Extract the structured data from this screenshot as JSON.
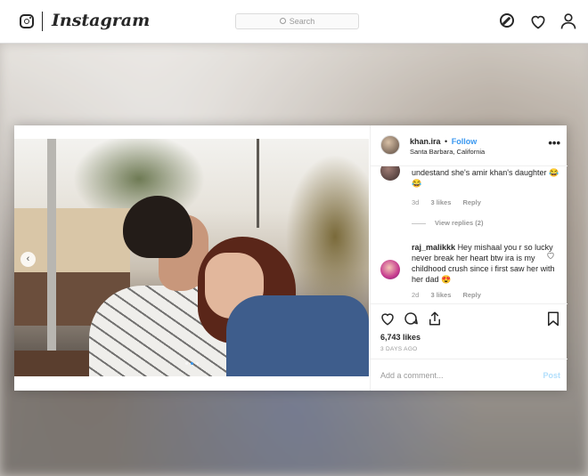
{
  "nav": {
    "logo": "Instagram",
    "search_placeholder": "Search"
  },
  "post": {
    "username": "khan.ira",
    "separator": "•",
    "follow_label": "Follow",
    "location": "Santa Barbara, California",
    "more_label": "•••",
    "carousel_prev": "‹",
    "carousel_dots": 3,
    "carousel_active": 1
  },
  "comments": [
    {
      "text": "undestand she's amir khan's daughter 😂😂",
      "age": "3d",
      "likes": "3 likes",
      "reply_label": "Reply",
      "view_replies": "View replies (2)"
    },
    {
      "user": "raj_malikkk",
      "text": "Hey mishaal you r so lucky never break her heart btw ira is my childhood crush since i first saw her with her dad 😍",
      "age": "2d",
      "likes": "3 likes",
      "reply_label": "Reply"
    }
  ],
  "footer": {
    "likes": "6,743 likes",
    "time": "3 DAYS AGO",
    "add_comment_placeholder": "Add a comment...",
    "post_label": "Post"
  },
  "colors": {
    "link_blue": "#3897f0",
    "post_disabled": "#b2dffc",
    "text": "#262626",
    "muted": "#999999"
  }
}
